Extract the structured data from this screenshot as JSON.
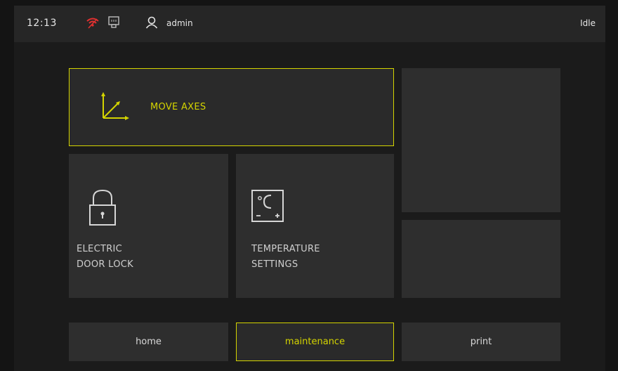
{
  "status": {
    "time": "12:13",
    "user": "admin",
    "state": "Idle",
    "icons": [
      "wifi-off-icon",
      "ethernet-icon",
      "user-icon"
    ]
  },
  "tiles": {
    "move_axes": {
      "label": "MOVE AXES",
      "icon": "axes-icon"
    },
    "door_lock": {
      "label": "ELECTRIC\nDOOR LOCK",
      "icon": "lock-icon"
    },
    "temperature": {
      "label": "TEMPERATURE\nSETTINGS",
      "icon": "temperature-icon"
    }
  },
  "nav": {
    "home": "home",
    "maintenance": "maintenance",
    "print": "print",
    "active": "maintenance"
  },
  "colors": {
    "accent": "#d4d400",
    "alert": "#e03030",
    "tile_bg": "#2e2e2e",
    "bar_bg": "#262626"
  }
}
